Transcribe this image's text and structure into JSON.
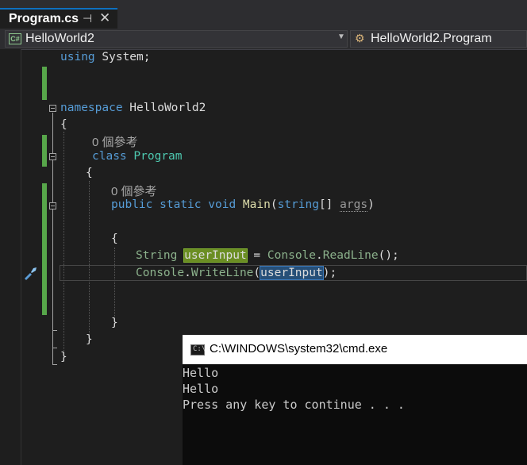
{
  "tab": {
    "title": "Program.cs",
    "pin_icon": "⊣",
    "close_icon": "✕"
  },
  "nav": {
    "file_badge": "C#",
    "left": "HelloWorld2",
    "right": "HelloWorld2.Program"
  },
  "code": {
    "using_kw": "using",
    "using_rest": " System;",
    "namespace_kw": "namespace",
    "namespace_name": " HelloWorld2",
    "brace_open": "{",
    "brace_close": "}",
    "refs_class": "0 個參考",
    "class_kw": "class",
    "class_name": "Program",
    "refs_main": "0 個參考",
    "public_kw": "public",
    "static_kw": "static",
    "void_kw": "void",
    "method_name": "Main",
    "paren_open": "(",
    "string_kw": "string",
    "array_args": "[] ",
    "args_name": "args",
    "paren_close": ")",
    "string_type": "String",
    "var_name": "userInput",
    "assign": " = ",
    "console1": "Console",
    "dot1": ".",
    "readline": "ReadLine",
    "end1": "();",
    "console2": "Console",
    "dot2": ".",
    "writeline": "WriteLine",
    "paren2": "(",
    "var_ref": "userInput",
    "end2": ");"
  },
  "console": {
    "title": "C:\\WINDOWS\\system32\\cmd.exe",
    "lines": [
      "Hello",
      "Hello",
      "Press any key to continue . . ."
    ]
  }
}
